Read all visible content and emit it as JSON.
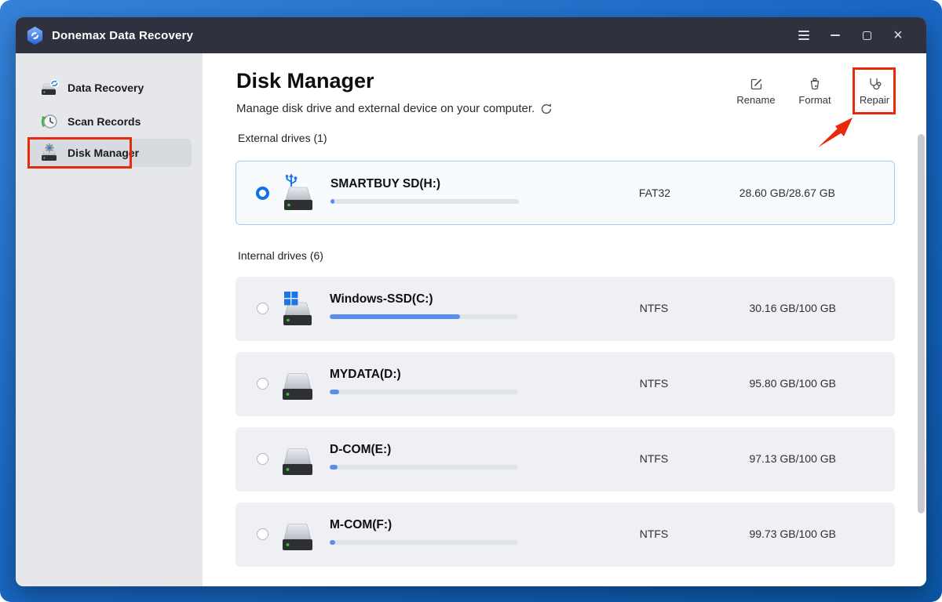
{
  "app": {
    "title": "Donemax Data Recovery"
  },
  "titlebar": {
    "controls": [
      {
        "name": "menu-icon"
      },
      {
        "name": "minimize-icon"
      },
      {
        "name": "maximize-icon"
      },
      {
        "name": "close-icon"
      }
    ]
  },
  "sidebar": {
    "items": [
      {
        "label": "Data Recovery",
        "icon": "drive-recovery-icon",
        "selected": false
      },
      {
        "label": "Scan Records",
        "icon": "scan-records-icon",
        "selected": false
      },
      {
        "label": "Disk Manager",
        "icon": "disk-manager-icon",
        "selected": true
      }
    ]
  },
  "header": {
    "title": "Disk Manager",
    "subtitle": "Manage disk drive and external device on your computer.",
    "refresh_icon": "refresh-icon"
  },
  "toolbar": {
    "buttons": [
      {
        "label": "Rename",
        "icon": "rename-icon",
        "highlighted": false
      },
      {
        "label": "Format",
        "icon": "format-icon",
        "highlighted": false
      },
      {
        "label": "Repair",
        "icon": "repair-icon",
        "highlighted": true
      }
    ]
  },
  "sections": {
    "external_label": "External drives (1)",
    "internal_label": "Internal drives (6)"
  },
  "drives": [
    {
      "name": "SMARTBUY SD(H:)",
      "filesystem": "FAT32",
      "capacity": "28.60 GB/28.67 GB",
      "used_pct": 2,
      "selected": true,
      "type": "external",
      "badge": "usb-icon"
    },
    {
      "name": "Windows-SSD(C:)",
      "filesystem": "NTFS",
      "capacity": "30.16 GB/100 GB",
      "used_pct": 69,
      "selected": false,
      "type": "internal",
      "badge": "windows-icon"
    },
    {
      "name": "MYDATA(D:)",
      "filesystem": "NTFS",
      "capacity": "95.80 GB/100 GB",
      "used_pct": 5,
      "selected": false,
      "type": "internal",
      "badge": "none"
    },
    {
      "name": "D-COM(E:)",
      "filesystem": "NTFS",
      "capacity": "97.13 GB/100 GB",
      "used_pct": 4,
      "selected": false,
      "type": "internal",
      "badge": "none"
    },
    {
      "name": "M-COM(F:)",
      "filesystem": "NTFS",
      "capacity": "99.73 GB/100 GB",
      "used_pct": 3,
      "selected": false,
      "type": "internal",
      "badge": "none"
    }
  ],
  "annotations": {
    "color": "#e8290c",
    "boxes": [
      "sidebar-disk-manager-item",
      "toolbar-repair-button"
    ],
    "arrow_target": "toolbar-repair-button"
  },
  "colors": {
    "accent_blue": "#1773e6",
    "titlebar_bg": "#2f323e",
    "sidebar_bg": "#e5e7ea",
    "card_bg": "#eef0f3",
    "selected_card_bg": "#f8fbfe",
    "selected_card_border": "#a8c8ef",
    "progress_fill": "#5b8df0",
    "frame_blue": "#1a68c4"
  }
}
